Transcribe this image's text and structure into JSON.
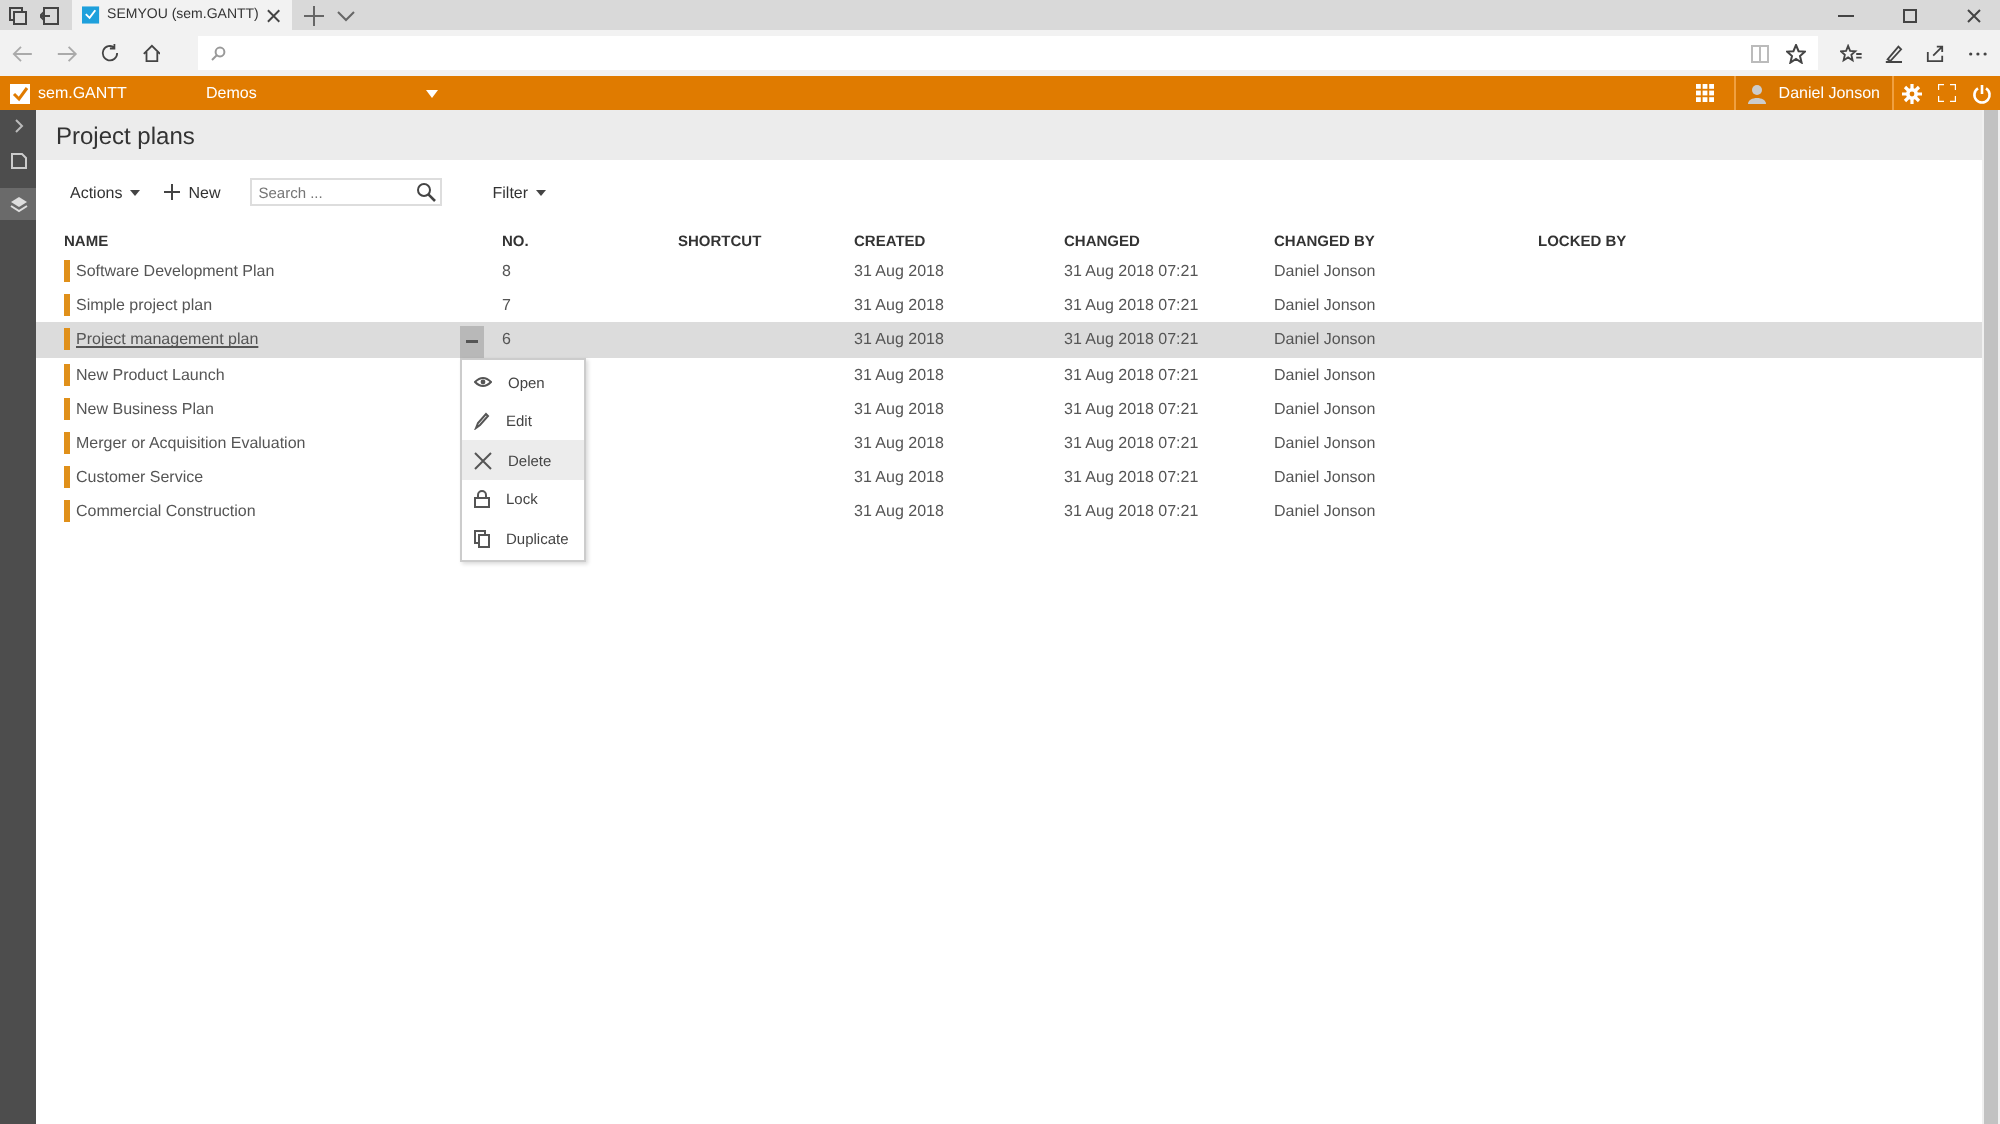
{
  "browser": {
    "tab_title": "SEMYOU (sem.GANTT)"
  },
  "app_bar": {
    "app_name": "sem.GANTT",
    "workspace": "Demos",
    "user": "Daniel Jonson"
  },
  "page": {
    "title": "Project plans"
  },
  "toolbar": {
    "actions": "Actions",
    "new": "New",
    "search": {
      "placeholder": "Search ..."
    },
    "filter": "Filter"
  },
  "table": {
    "columns": [
      "NAME",
      "NO.",
      "SHORTCUT",
      "CREATED",
      "CHANGED",
      "CHANGED BY",
      "LOCKED BY"
    ],
    "rows": [
      {
        "name": "Software Development Plan",
        "no": "8",
        "created": "31 Aug 2018",
        "changed": "31 Aug 2018 07:21",
        "changed_by": "Daniel Jonson",
        "selected": false
      },
      {
        "name": "Simple project plan",
        "no": "7",
        "created": "31 Aug 2018",
        "changed": "31 Aug 2018 07:21",
        "changed_by": "Daniel Jonson",
        "selected": false
      },
      {
        "name": "Project management plan",
        "no": "6",
        "created": "31 Aug 2018",
        "changed": "31 Aug 2018 07:21",
        "changed_by": "Daniel Jonson",
        "selected": true
      },
      {
        "name": "New Product Launch",
        "created": "31 Aug 2018",
        "changed": "31 Aug 2018 07:21",
        "changed_by": "Daniel Jonson",
        "selected": false
      },
      {
        "name": "New Business Plan",
        "created": "31 Aug 2018",
        "changed": "31 Aug 2018 07:21",
        "changed_by": "Daniel Jonson",
        "selected": false
      },
      {
        "name": "Merger or Acquisition Evaluation",
        "created": "31 Aug 2018",
        "changed": "31 Aug 2018 07:21",
        "changed_by": "Daniel Jonson",
        "selected": false
      },
      {
        "name": "Customer Service",
        "created": "31 Aug 2018",
        "changed": "31 Aug 2018 07:21",
        "changed_by": "Daniel Jonson",
        "selected": false
      },
      {
        "name": "Commercial Construction",
        "created": "31 Aug 2018",
        "changed": "31 Aug 2018 07:21",
        "changed_by": "Daniel Jonson",
        "selected": false
      }
    ]
  },
  "context_menu": {
    "items": [
      {
        "kind": "open",
        "label": "Open",
        "selected": false
      },
      {
        "kind": "edit",
        "label": "Edit",
        "selected": false
      },
      {
        "kind": "delete",
        "label": "Delete",
        "selected": true
      },
      {
        "kind": "lock",
        "label": "Lock",
        "selected": false
      },
      {
        "kind": "duplicate",
        "label": "Duplicate",
        "selected": false
      }
    ]
  }
}
